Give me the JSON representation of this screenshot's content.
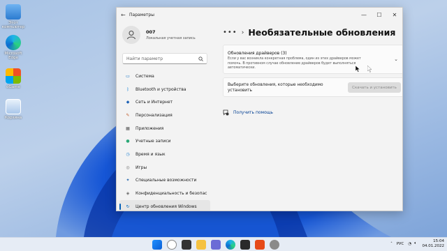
{
  "desktop": {
    "icons": [
      {
        "label": "Этот компьютер",
        "icon": "computer-icon"
      },
      {
        "label": "Microsoft Edge",
        "icon": "edge-icon"
      },
      {
        "label": "oGame",
        "icon": "ogame-icon"
      },
      {
        "label": "Корзина",
        "icon": "recycle-bin-icon"
      }
    ]
  },
  "window": {
    "title": "Параметры",
    "profile": {
      "name": "007",
      "subtitle": "Локальная учетная запись"
    },
    "search_placeholder": "Найти параметр",
    "nav": [
      {
        "label": "Система",
        "icon": "monitor-icon",
        "color": "#0067c0"
      },
      {
        "label": "Bluetooth и устройства",
        "icon": "bluetooth-icon",
        "color": "#0078d4"
      },
      {
        "label": "Сеть и Интернет",
        "icon": "wifi-icon",
        "color": "#1a5fb4"
      },
      {
        "label": "Персонализация",
        "icon": "brush-icon",
        "color": "#c05a2b"
      },
      {
        "label": "Приложения",
        "icon": "apps-icon",
        "color": "#555555"
      },
      {
        "label": "Учетные записи",
        "icon": "account-icon",
        "color": "#2aa876"
      },
      {
        "label": "Время и язык",
        "icon": "globe-clock-icon",
        "color": "#1f7fcf"
      },
      {
        "label": "Игры",
        "icon": "gamepad-icon",
        "color": "#777777"
      },
      {
        "label": "Специальные возможности",
        "icon": "accessibility-icon",
        "color": "#2b6cb0"
      },
      {
        "label": "Конфиденциальность и безопас",
        "icon": "shield-icon",
        "color": "#666666"
      },
      {
        "label": "Центр обновления Windows",
        "icon": "update-icon",
        "color": "#0067c0"
      }
    ],
    "active_nav_index": 10,
    "breadcrumb_ellipsis": "•••",
    "breadcrumb_sep": "›",
    "page_title": "Необязательные обновления",
    "drivers_card": {
      "title": "Обновления драйверов (3)",
      "description": "Если у вас возникла конкретная проблема, один из этих драйверов может помочь. В противном случае обновление драйверов будет выполняться автоматически."
    },
    "update_card": {
      "text": "Выберите обновления, которые необходимо установить",
      "button": "Скачать и установить"
    },
    "help_link": "Получить помощь"
  },
  "taskbar": {
    "apps": [
      "windows-start-icon",
      "search-icon",
      "task-view-icon",
      "file-explorer-icon",
      "chat-icon",
      "edge-icon",
      "store-icon",
      "office-icon",
      "settings-icon"
    ],
    "language": "РУС",
    "time": "15:04",
    "date": "04.01.2022"
  },
  "colors": {
    "accent": "#005fb8",
    "link": "#003e92"
  }
}
